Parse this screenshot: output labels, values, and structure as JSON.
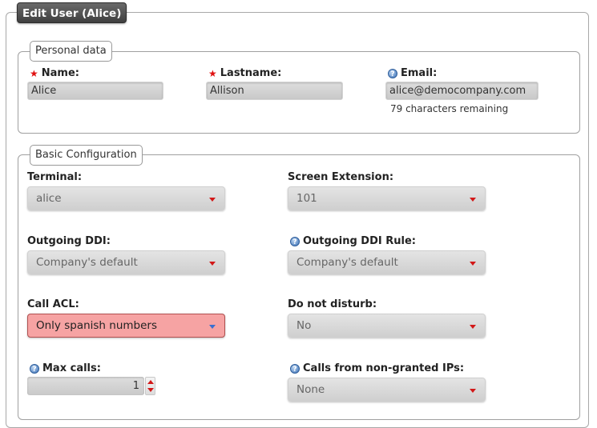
{
  "form": {
    "title": "Edit User (Alice)",
    "personal": {
      "legend": "Personal data",
      "name_label": "Name:",
      "name_value": "Alice",
      "lastname_label": "Lastname:",
      "lastname_value": "Allison",
      "email_label": "Email:",
      "email_value": "alice@democompany.com",
      "email_hint": "79 characters remaining"
    },
    "basic": {
      "legend": "Basic Configuration",
      "terminal_label": "Terminal:",
      "terminal_value": "alice",
      "screen_ext_label": "Screen Extension:",
      "screen_ext_value": "101",
      "outgoing_ddi_label": "Outgoing DDI:",
      "outgoing_ddi_value": "Company's default",
      "outgoing_ddi_rule_label": "Outgoing DDI Rule:",
      "outgoing_ddi_rule_value": "Company's default",
      "call_acl_label": "Call ACL:",
      "call_acl_value": "Only spanish numbers",
      "dnd_label": "Do not disturb:",
      "dnd_value": "No",
      "max_calls_label": "Max calls:",
      "max_calls_value": "1",
      "non_granted_label": "Calls from non-granted IPs:",
      "non_granted_value": "None"
    }
  },
  "icons": {
    "required": "asterisk-icon",
    "help": "help-icon",
    "dropdown": "chevron-down-icon"
  },
  "colors": {
    "required_star": "#e01010",
    "dropdown_arrow": "#d21818",
    "alert_select_bg": "#f6a3a3",
    "help_icon": "#3e73b8"
  }
}
